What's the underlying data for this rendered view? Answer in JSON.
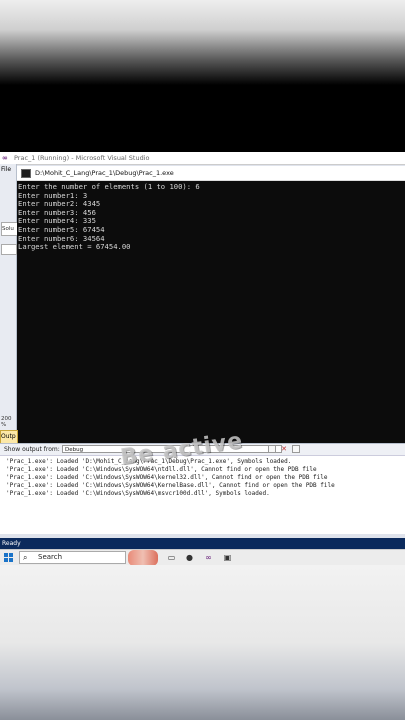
{
  "vs": {
    "title": "Prac_1 (Running) - Microsoft Visual Studio",
    "file_menu": "File",
    "solution_label": "Solu",
    "zoom": "200 %"
  },
  "console": {
    "path": "D:\\Mohit_C_Lang\\Prac_1\\Debug\\Prac_1.exe",
    "lines": [
      "Enter the number of elements (1 to 100): 6",
      "Enter number1: 3",
      "Enter number2: 4345",
      "Enter number3: 456",
      "Enter number4: 335",
      "Enter number5: 67454",
      "Enter number6: 34564",
      "Largest element = 67454.00"
    ]
  },
  "output": {
    "tab_label": "Outp",
    "show_output_label": "Show output from:",
    "source": "Debug",
    "lines": [
      "'Prac_1.exe': Loaded 'D:\\Mohit_C_Lang\\Prac_1\\Debug\\Prac_1.exe', Symbols loaded.",
      "'Prac_1.exe': Loaded 'C:\\Windows\\SysWOW64\\ntdll.dll', Cannot find or open the PDB file",
      "'Prac_1.exe': Loaded 'C:\\Windows\\SysWOW64\\kernel32.dll', Cannot find or open the PDB file",
      "'Prac_1.exe': Loaded 'C:\\Windows\\SysWOW64\\KernelBase.dll', Cannot find or open the PDB file",
      "'Prac_1.exe': Loaded 'C:\\Windows\\SysWOW64\\msvcr100d.dll', Symbols loaded."
    ]
  },
  "status": {
    "text": "Ready"
  },
  "taskbar": {
    "search_placeholder": "Search"
  },
  "watermark": {
    "text": "Be active"
  }
}
